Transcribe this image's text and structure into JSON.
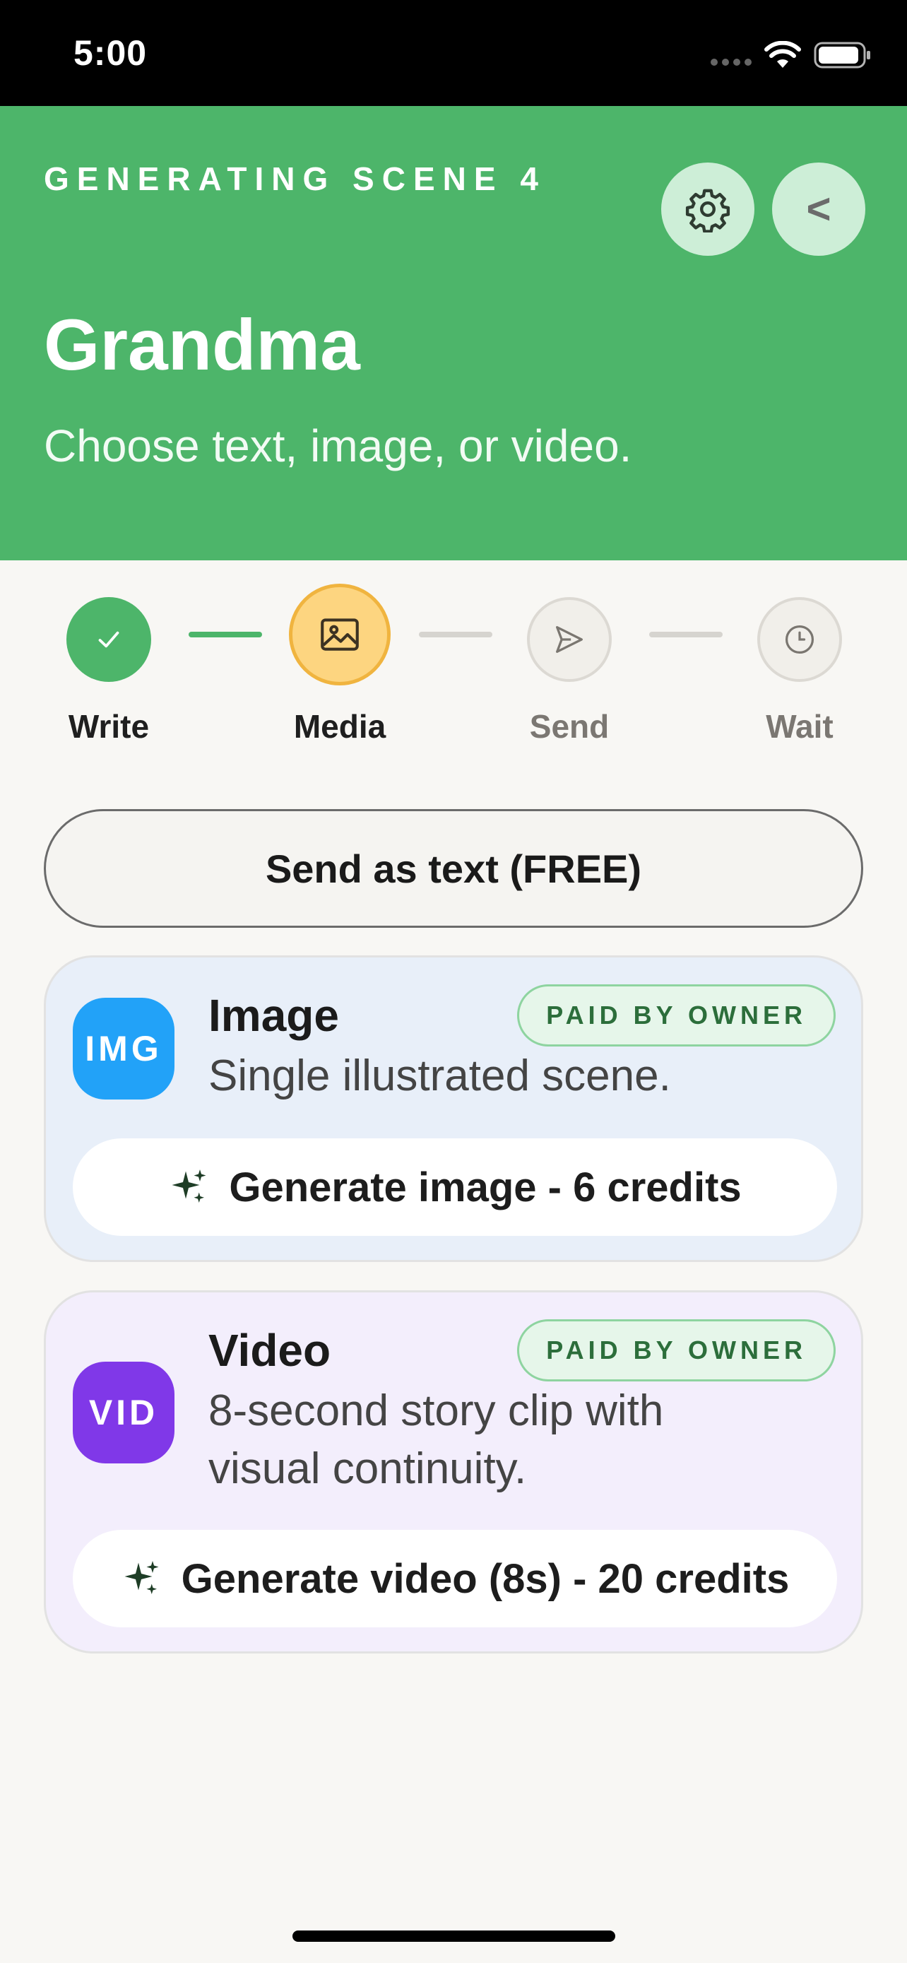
{
  "status_bar": {
    "time": "5:00"
  },
  "header": {
    "eyebrow": "GENERATING SCENE 4",
    "recipient": "Grandma",
    "subtitle": "Choose text, image, or video.",
    "colors": {
      "background": "#4db56a",
      "button": "#cdeed7"
    },
    "settings_icon": "gear-icon",
    "back_icon": "chevron-left-icon"
  },
  "stepper": {
    "current_step": "Media",
    "steps": [
      {
        "label": "Write",
        "state": "done",
        "icon": "check-icon"
      },
      {
        "label": "Media",
        "state": "active",
        "icon": "image-icon"
      },
      {
        "label": "Send",
        "state": "upcoming",
        "icon": "send-icon"
      },
      {
        "label": "Wait",
        "state": "upcoming",
        "icon": "clock-icon"
      }
    ]
  },
  "text_option": {
    "label": "Send as text (FREE)"
  },
  "options": {
    "image": {
      "badge": "IMG",
      "title": "Image",
      "description": "Single illustrated scene.",
      "paid_label": "PAID BY OWNER",
      "action_label": "Generate image - 6 credits",
      "action_icon": "sparkle-icon",
      "accent": "#22a2f8"
    },
    "video": {
      "badge": "VID",
      "title": "Video",
      "description": "8-second story clip with visual continuity.",
      "paid_label": "PAID BY OWNER",
      "action_label": "Generate video (8s) - 20 credits",
      "action_icon": "sparkle-icon",
      "accent": "#8038e8"
    }
  }
}
